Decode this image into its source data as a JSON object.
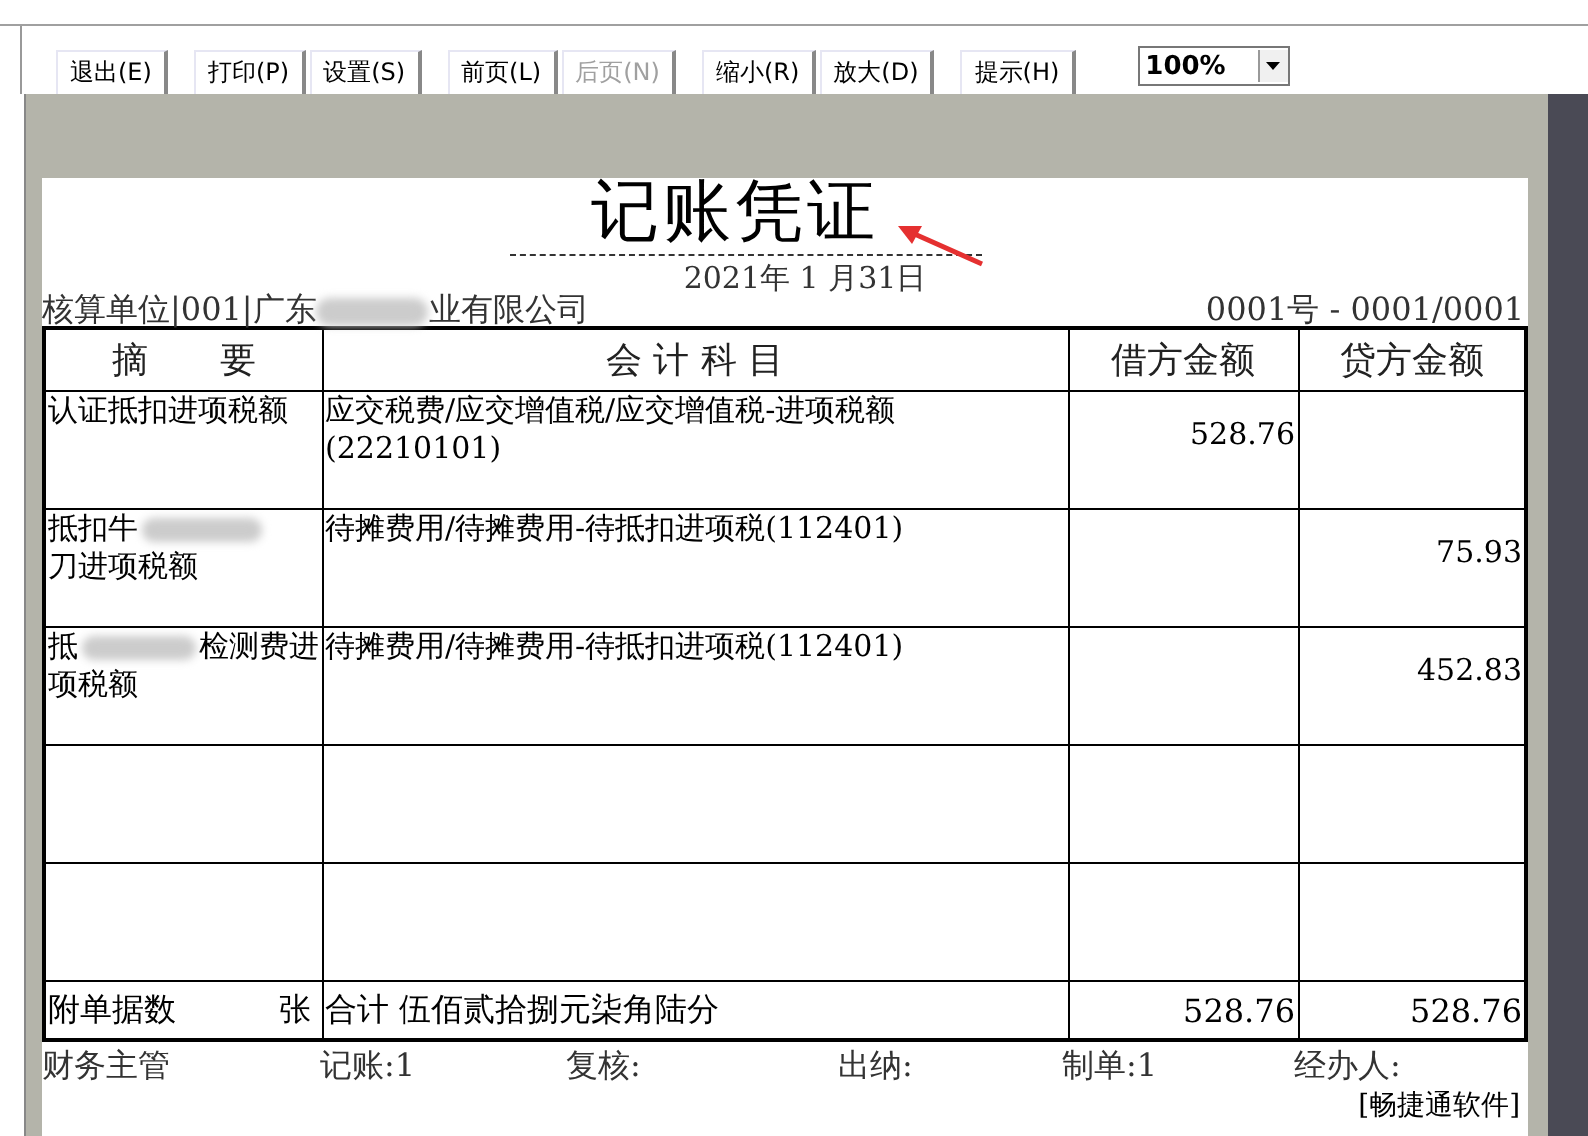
{
  "toolbar": {
    "buttons": [
      {
        "label": "退出(E)",
        "disabled": false
      },
      {
        "label": "打印(P)",
        "disabled": false
      },
      {
        "label": "设置(S)",
        "disabled": false
      },
      {
        "label": "前页(L)",
        "disabled": false
      },
      {
        "label": "后页(N)",
        "disabled": true
      },
      {
        "label": "缩小(R)",
        "disabled": false
      },
      {
        "label": "放大(D)",
        "disabled": false
      },
      {
        "label": "提示(H)",
        "disabled": false
      }
    ],
    "zoom": {
      "value": "100%"
    }
  },
  "voucher": {
    "title": "记账凭证",
    "date": "2021年 1 月31日",
    "unit_start": "核算单位|001|广东",
    "unit_end": "业有限公司",
    "number": "0001号 - 0001/0001",
    "columns": [
      "摘　　要",
      "会 计 科 目",
      "借方金额",
      "贷方金额"
    ],
    "rows": [
      {
        "summary": [
          [
            "认证抵扣进项税额"
          ]
        ],
        "account": "应交税费/应交增值税/应交增值税-进项税额(22210101)",
        "debit": "528.76",
        "credit": ""
      },
      {
        "summary": [
          [
            "抵扣牛"
          ],
          [
            "刀进项税额"
          ]
        ],
        "account": "待摊费用/待摊费用-待抵扣进项税(112401)",
        "debit": "",
        "credit": "75.93"
      },
      {
        "summary": [
          [
            "抵",
            "检测费进"
          ],
          [
            "项税额"
          ]
        ],
        "account": "待摊费用/待摊费用-待抵扣进项税(112401)",
        "debit": "",
        "credit": "452.83"
      },
      {
        "account": "",
        "debit": "",
        "credit": ""
      },
      {
        "account": "",
        "debit": "",
        "credit": ""
      }
    ],
    "attachments_label": "附单据数",
    "attachments_unit": "张",
    "total_label": "合计 伍佰贰拾捌元柒角陆分",
    "total_debit": "528.76",
    "total_credit": "528.76",
    "signatures": [
      "财务主管",
      "记账:1",
      "复核:",
      "出纳:",
      "制单:1",
      "经办人:"
    ],
    "software": "[畅捷通软件]"
  }
}
